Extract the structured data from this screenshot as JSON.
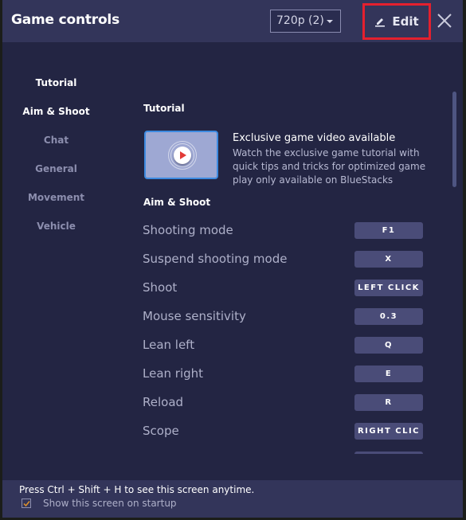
{
  "header": {
    "title": "Game controls",
    "resolution_select": "720p (2)",
    "edit_label": "Edit",
    "colors": {
      "header_bg": "#33355a",
      "body_bg": "#232543",
      "highlight_border": "#e4202e"
    }
  },
  "sidebar": {
    "items": [
      {
        "label": "Tutorial",
        "active": true
      },
      {
        "label": "Aim & Shoot",
        "active": true
      },
      {
        "label": "Chat",
        "active": false
      },
      {
        "label": "General",
        "active": false
      },
      {
        "label": "Movement",
        "active": false
      },
      {
        "label": "Vehicle",
        "active": false
      }
    ]
  },
  "tutorial": {
    "section_title": "Tutorial",
    "video_title": "Exclusive game video available",
    "video_description": "Watch the exclusive game tutorial with quick tips and tricks for optimized game play only available on BlueStacks",
    "icon": "play-icon"
  },
  "aim_shoot": {
    "section_title": "Aim & Shoot",
    "controls": [
      {
        "label": "Shooting mode",
        "key": "F1"
      },
      {
        "label": "Suspend shooting mode",
        "key": "X"
      },
      {
        "label": "Shoot",
        "key": "LEFT CLICK"
      },
      {
        "label": "Mouse sensitivity",
        "key": "0.3"
      },
      {
        "label": "Lean left",
        "key": "Q"
      },
      {
        "label": "Lean right",
        "key": "E"
      },
      {
        "label": "Reload",
        "key": "R"
      },
      {
        "label": "Scope",
        "key": "RIGHT CLIC"
      }
    ]
  },
  "footer": {
    "hint": "Press Ctrl + Shift + H to see this screen anytime.",
    "startup_label": "Show this screen on startup",
    "startup_checked": true
  }
}
